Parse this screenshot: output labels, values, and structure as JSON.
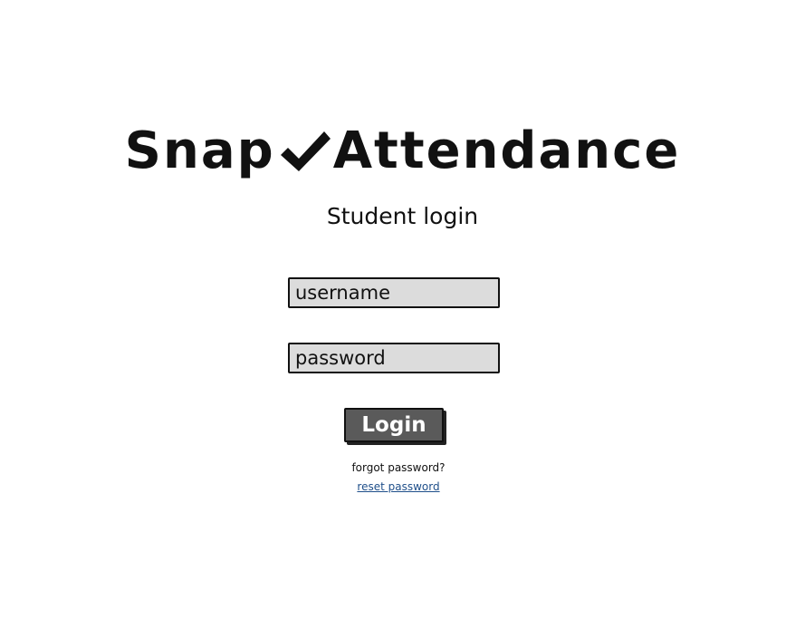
{
  "app": {
    "logo_left": "Snap",
    "logo_right": "Attendance",
    "logo_icon": "checkmark-icon",
    "subtitle": "Student login"
  },
  "form": {
    "username_placeholder": "username",
    "password_placeholder": "password",
    "login_label": "Login"
  },
  "help": {
    "forgot_text": "forgot password?",
    "reset_link": "reset password"
  },
  "colors": {
    "field_background": "#dcdcdc",
    "button_background": "#5a5a5a",
    "link": "#1f4f8a"
  }
}
